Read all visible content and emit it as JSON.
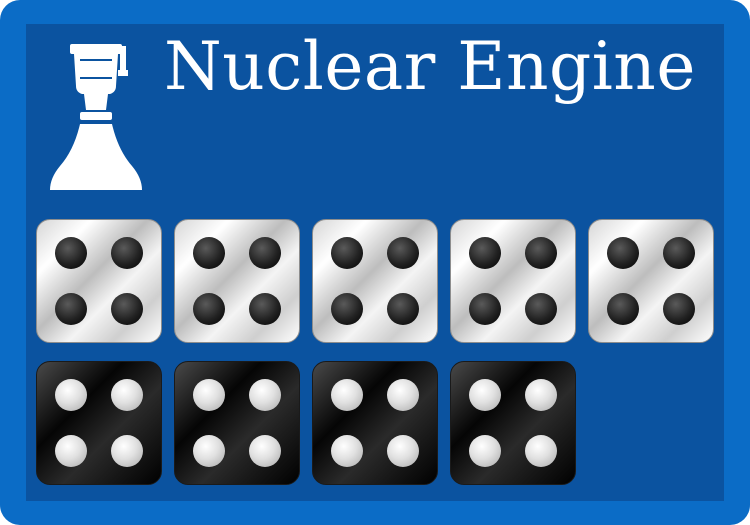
{
  "card": {
    "title": "Nuclear Engine",
    "icon": "rocket-nozzle-icon",
    "colors": {
      "border": "#0b6cc6",
      "panel": "#0b53a0",
      "text": "#ffffff"
    }
  },
  "dice": {
    "white": {
      "count": 5,
      "face_value": 4
    },
    "black": {
      "count": 4,
      "face_value": 4
    }
  }
}
